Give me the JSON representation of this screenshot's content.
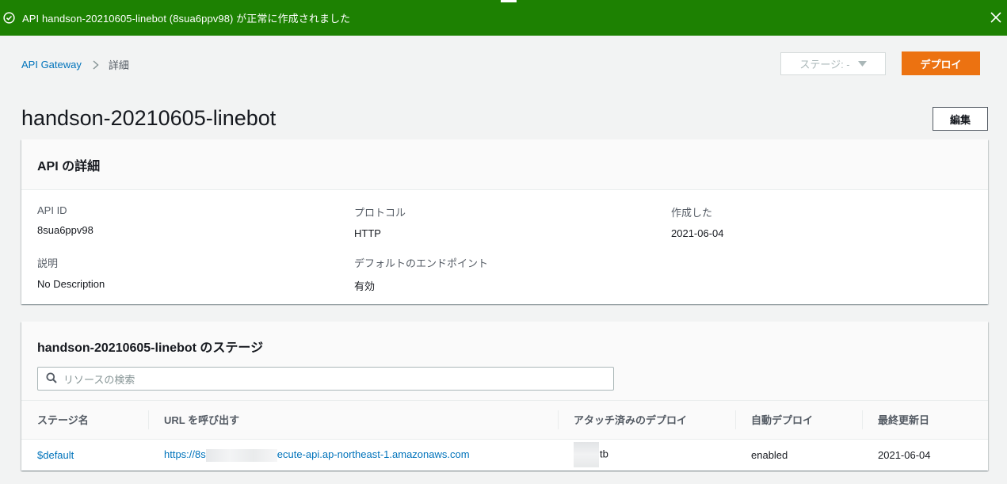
{
  "flash": {
    "message": "API handson-20210605-linebot (8sua6ppv98) が正常に作成されました",
    "color": "#1d8102"
  },
  "breadcrumb": {
    "root": "API Gateway",
    "current": "詳細"
  },
  "toolbar": {
    "stage_select": "ステージ: -",
    "deploy_label": "デプロイ",
    "edit_label": "編集"
  },
  "page": {
    "title": "handson-20210605-linebot"
  },
  "details": {
    "heading": "API の詳細",
    "fields": [
      {
        "label": "API ID",
        "value": "8sua6ppv98"
      },
      {
        "label": "プロトコル",
        "value": "HTTP"
      },
      {
        "label": "作成した",
        "value": "2021-06-04"
      },
      {
        "label": "説明",
        "value": "No Description"
      },
      {
        "label": "デフォルトのエンドポイント",
        "value": "有効"
      }
    ]
  },
  "stages": {
    "heading": "handson-20210605-linebot のステージ",
    "search_placeholder": "リソースの検索",
    "columns": [
      "ステージ名",
      "URL を呼び出す",
      "アタッチ済みのデプロイ",
      "自動デプロイ",
      "最終更新日"
    ],
    "rows": [
      {
        "name": "$default",
        "url_prefix": "https://8s",
        "url_suffix": "ecute-api.ap-northeast-1.amazonaws.com",
        "deployment_suffix": "tb",
        "auto_deploy": "enabled",
        "updated": "2021-06-04"
      }
    ]
  },
  "colors": {
    "link": "#0073bb",
    "primary_button": "#ec7211"
  }
}
